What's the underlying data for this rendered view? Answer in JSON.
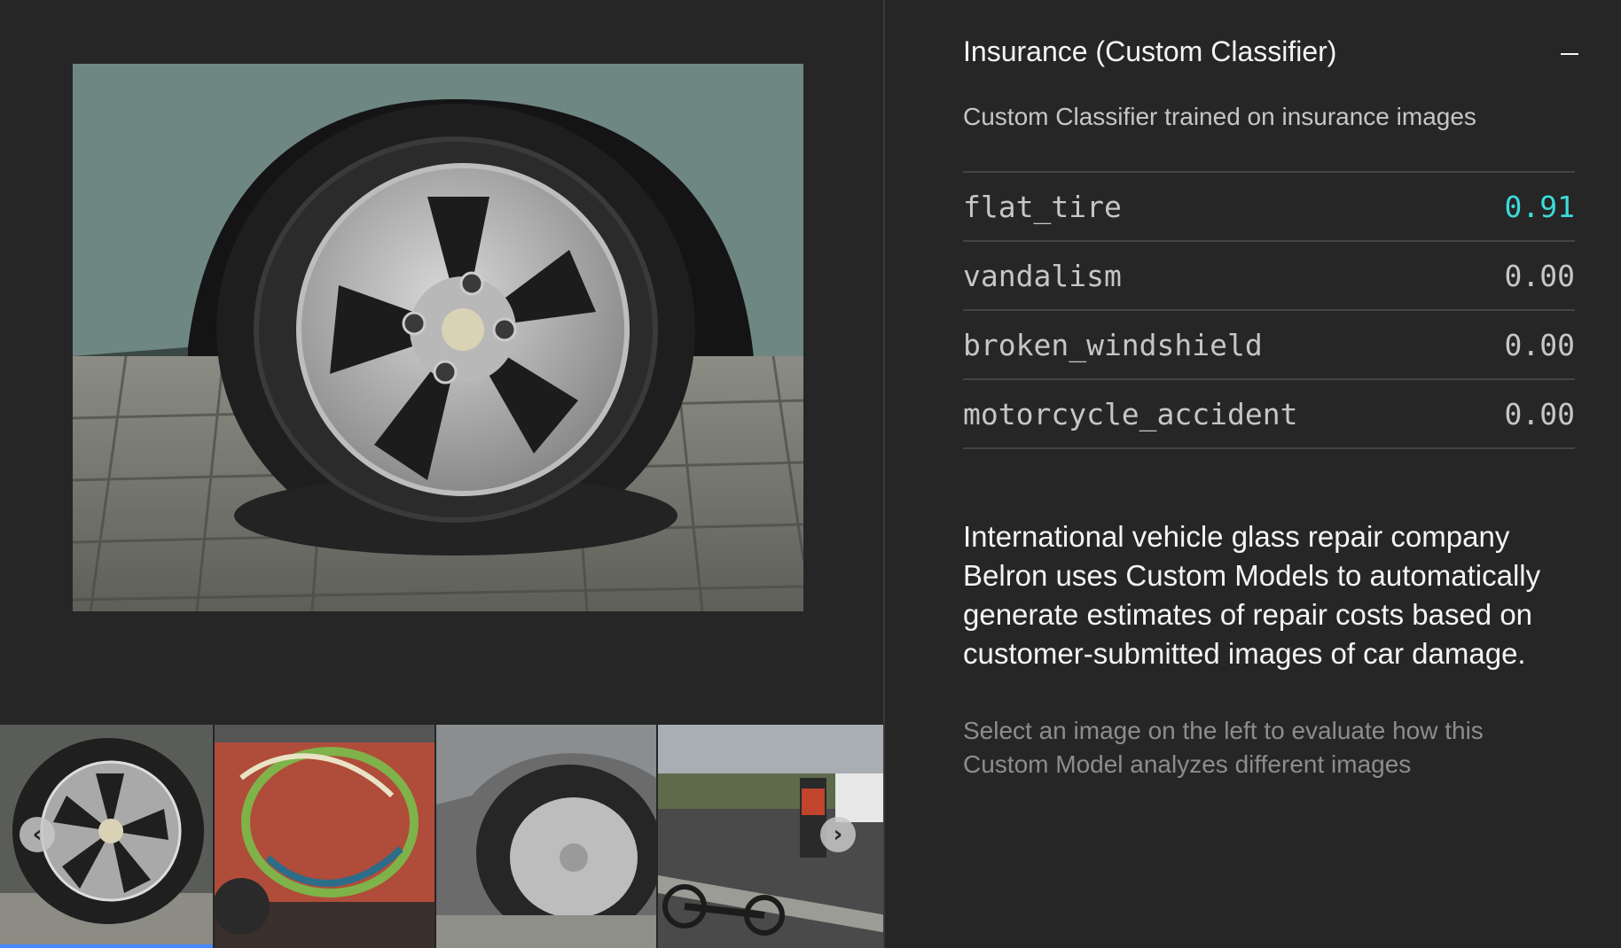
{
  "panel": {
    "title": "Insurance (Custom Classifier)",
    "collapse_icon": "minus-icon",
    "description": "Custom Classifier trained on insurance images"
  },
  "results": [
    {
      "label": "flat_tire",
      "score": "0.91",
      "highlight": true
    },
    {
      "label": "vandalism",
      "score": "0.00",
      "highlight": false
    },
    {
      "label": "broken_windshield",
      "score": "0.00",
      "highlight": false
    },
    {
      "label": "motorcycle_accident",
      "score": "0.00",
      "highlight": false
    }
  ],
  "story": "International vehicle glass repair company Belron uses Custom Models to automatically generate estimates of repair costs based on customer-submitted images of car damage.",
  "hint": "Select an image on the left to evaluate how this Custom Model analyzes different images",
  "carousel": {
    "prev_icon": "chevron-left-icon",
    "next_icon": "chevron-right-icon",
    "selected_index": 0,
    "thumbnails": [
      "flat-tire",
      "graffiti-van",
      "flat-tire-hubcap",
      "motorcycle-accident"
    ]
  },
  "colors": {
    "background": "#262626",
    "highlight_score": "#3ddbd9",
    "selection": "#4589ff"
  }
}
